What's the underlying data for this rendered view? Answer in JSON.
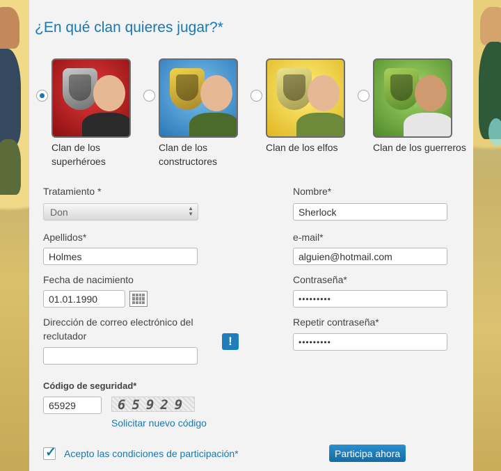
{
  "title": "¿En qué clan quieres jugar?*",
  "clans": [
    {
      "label": "Clan de los superhéroes",
      "selected": true,
      "color": "#c81e22"
    },
    {
      "label": "Clan de los constructores",
      "selected": false,
      "color": "#3f8fd4"
    },
    {
      "label": "Clan de los elfos",
      "selected": false,
      "color": "#f1d43a"
    },
    {
      "label": "Clan de los guerreros",
      "selected": false,
      "color": "#6aab39"
    }
  ],
  "form": {
    "tratamiento_label": "Tratamiento *",
    "tratamiento_value": "Don",
    "nombre_label": "Nombre*",
    "nombre_value": "Sherlock",
    "apellidos_label": "Apellidos*",
    "apellidos_value": "Holmes",
    "email_label": "e-mail*",
    "email_value": "alguien@hotmail.com",
    "fecha_label": "Fecha de nacimiento",
    "fecha_value": "01.01.1990",
    "contrasena_label": "Contraseña*",
    "contrasena_value": "•••••••••",
    "reclutador_label": "Dirección de correo electrónico del reclutador",
    "reclutador_value": "",
    "repetir_label": "Repetir contraseña*",
    "repetir_value": "•••••••••",
    "info_icon": "!",
    "codigo_label": "Código de seguridad*",
    "codigo_value": "65929",
    "captcha_text": "65929",
    "nuevo_codigo": "Solicitar nuevo código",
    "acepto_label": "Acepto las condiciones de participación*",
    "acepto_checked": true,
    "participa_label": "Participa ahora"
  },
  "colors": {
    "accent": "#1579b4",
    "panel": "#f3f3f3"
  }
}
